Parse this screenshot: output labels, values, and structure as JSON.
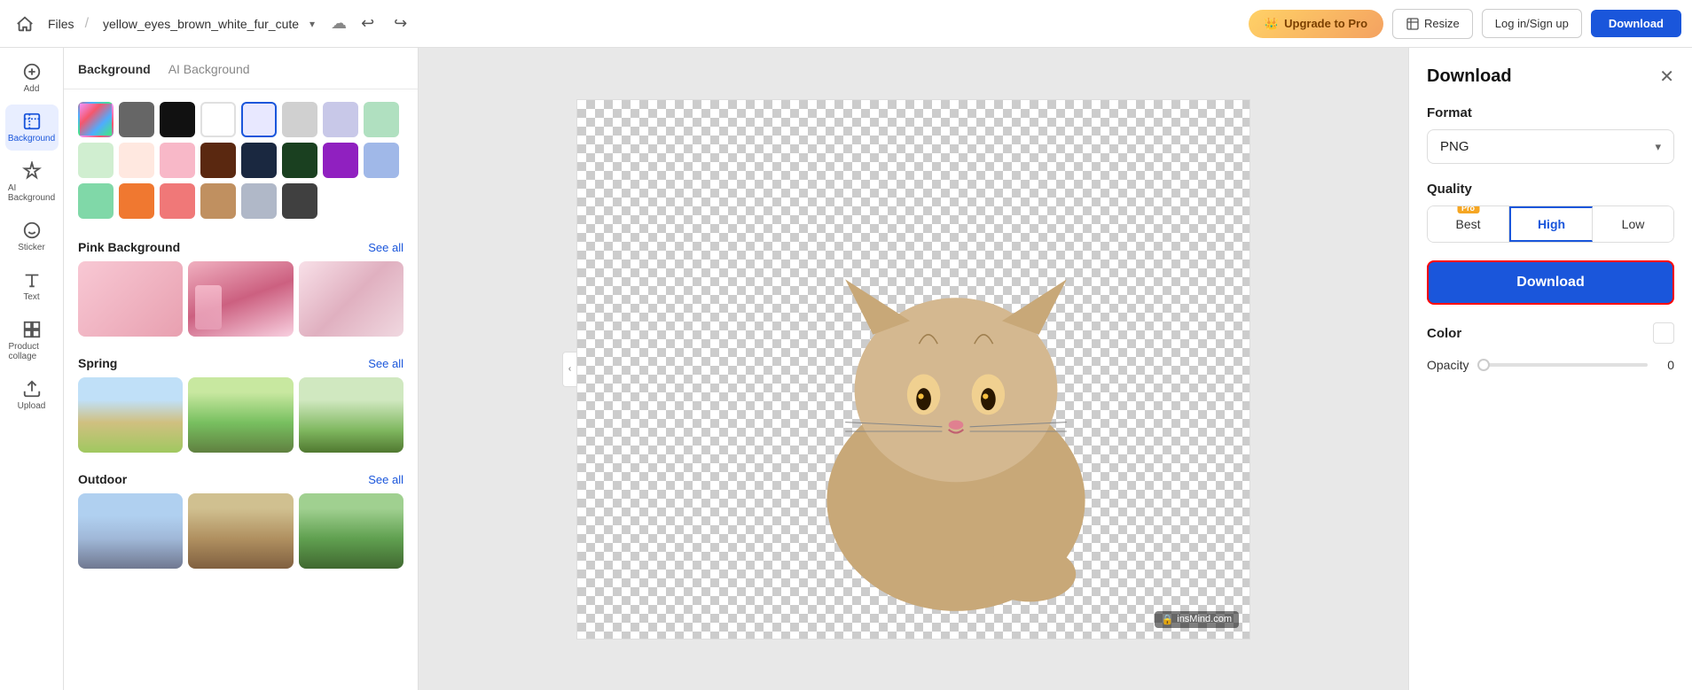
{
  "topbar": {
    "files_label": "Files",
    "filename": "yellow_eyes_brown_white_fur_cute",
    "upgrade_label": "Upgrade to Pro",
    "resize_label": "Resize",
    "login_label": "Log in/Sign up",
    "download_label": "Download"
  },
  "left_sidebar": {
    "items": [
      {
        "id": "add",
        "label": "Add",
        "icon": "plus"
      },
      {
        "id": "background",
        "label": "Background",
        "icon": "background",
        "active": true
      },
      {
        "id": "ai-background",
        "label": "AI\nBackground",
        "icon": "ai"
      },
      {
        "id": "sticker",
        "label": "Sticker",
        "icon": "sticker"
      },
      {
        "id": "text",
        "label": "Text",
        "icon": "text"
      },
      {
        "id": "product-collage",
        "label": "Product collage",
        "icon": "collage"
      },
      {
        "id": "upload",
        "label": "Upload",
        "icon": "upload"
      }
    ]
  },
  "background_panel": {
    "tab_background": "Background",
    "tab_ai": "AI Background",
    "sections": [
      {
        "id": "colors",
        "swatches": [
          {
            "type": "gradient",
            "selected": false
          },
          {
            "color": "#666666",
            "selected": false
          },
          {
            "color": "#111111",
            "selected": false
          },
          {
            "color": "#ffffff",
            "selected": false
          },
          {
            "color": "#e8e8ff",
            "selected": true,
            "border": true
          },
          {
            "color": "#cccccc",
            "selected": false
          },
          {
            "color": "#c0c0e0",
            "selected": false
          },
          {
            "color": "#c0e8c0",
            "selected": false
          },
          {
            "color": "#d0e8d0",
            "selected": false
          },
          {
            "color": "#ffe8e0",
            "selected": false
          },
          {
            "color": "#f8c0c8",
            "selected": false
          },
          {
            "color": "#6a3020",
            "selected": false
          },
          {
            "color": "#1a2840",
            "selected": false
          },
          {
            "color": "#1a4020",
            "selected": false
          },
          {
            "color": "#9020c0",
            "selected": false
          },
          {
            "color": "#b0c8f0",
            "selected": false
          },
          {
            "color": "#90e0b0",
            "selected": false
          },
          {
            "color": "#f08030",
            "selected": false
          },
          {
            "color": "#f08080",
            "selected": false
          },
          {
            "color": "#c09060",
            "selected": false
          },
          {
            "color": "#b0b8c8",
            "selected": false
          },
          {
            "color": "#404040",
            "selected": false
          }
        ]
      },
      {
        "id": "pink",
        "title": "Pink Background",
        "see_all": "See all",
        "images": [
          "pink1",
          "pink2",
          "pink3"
        ]
      },
      {
        "id": "spring",
        "title": "Spring",
        "see_all": "See all",
        "images": [
          "spring1",
          "spring2",
          "spring3"
        ]
      },
      {
        "id": "outdoor",
        "title": "Outdoor",
        "see_all": "See all",
        "images": [
          "outdoor1",
          "outdoor2",
          "outdoor3"
        ]
      }
    ]
  },
  "download_panel": {
    "title": "Download",
    "format_label": "Format",
    "format_value": "PNG",
    "quality_label": "Quality",
    "quality_options": [
      {
        "id": "best",
        "label": "Best",
        "has_pro": true
      },
      {
        "id": "high",
        "label": "High",
        "active": true
      },
      {
        "id": "low",
        "label": "Low"
      }
    ],
    "download_button": "Download",
    "color_label": "Color",
    "opacity_label": "Opacity",
    "opacity_value": "0"
  },
  "canvas": {
    "watermark": "insMind.com"
  }
}
